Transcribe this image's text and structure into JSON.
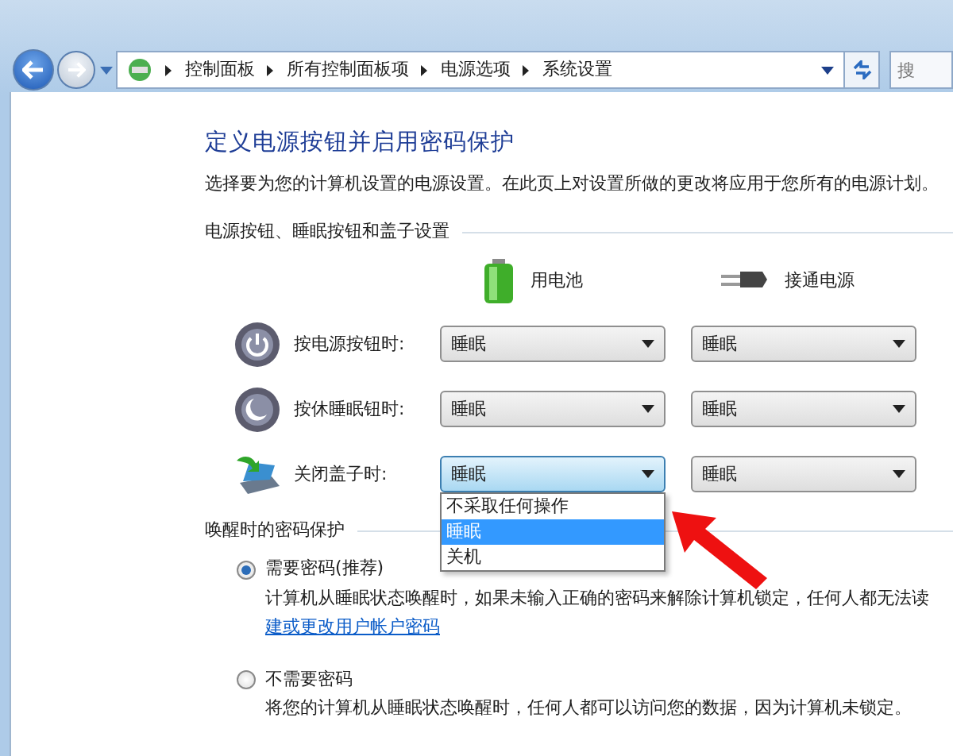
{
  "navigation": {
    "breadcrumb": [
      "控制面板",
      "所有控制面板项",
      "电源选项",
      "系统设置"
    ],
    "search": {
      "placeholder": "搜"
    }
  },
  "heading": "定义电源按钮并启用密码保护",
  "description": "选择要为您的计算机设置的电源设置。在此页上对设置所做的更改将应用于您所有的电源计划。",
  "button_section": {
    "title": "电源按钮、睡眠按钮和盖子设置",
    "columns": [
      {
        "label": "用电池",
        "kind": "battery"
      },
      {
        "label": "接通电源",
        "kind": "plug"
      }
    ],
    "rows": [
      {
        "label": "按电源按钮时:",
        "kind": "power",
        "settings": [
          {
            "value": "睡眠",
            "expanded": false
          },
          {
            "value": "睡眠",
            "expanded": false
          }
        ]
      },
      {
        "label": "按休睡眠钮时:",
        "kind": "sleep",
        "settings": [
          {
            "value": "睡眠",
            "expanded": false
          },
          {
            "value": "睡眠",
            "expanded": false
          }
        ]
      },
      {
        "label": "关闭盖子时:",
        "kind": "lid",
        "settings": [
          {
            "value": "睡眠",
            "expanded": true,
            "options": [
              {
                "label": "不采取任何操作",
                "selected": false
              },
              {
                "label": "睡眠",
                "selected": true
              },
              {
                "label": "关机",
                "selected": false
              }
            ]
          },
          {
            "value": "睡眠",
            "expanded": false
          }
        ]
      }
    ]
  },
  "password_section": {
    "title": "唤醒时的密码保护",
    "options": [
      {
        "label": "需要密码(推荐)",
        "selected": true,
        "description": "计算机从睡眠状态唤醒时，如果未输入正确的密码来解除计算机锁定，任何人都无法读",
        "link": "建或更改用户帐户密码"
      },
      {
        "label": "不需要密码",
        "selected": false,
        "description": "将您的计算机从睡眠状态唤醒时，任何人都可以访问您的数据，因为计算机未锁定。"
      }
    ]
  }
}
